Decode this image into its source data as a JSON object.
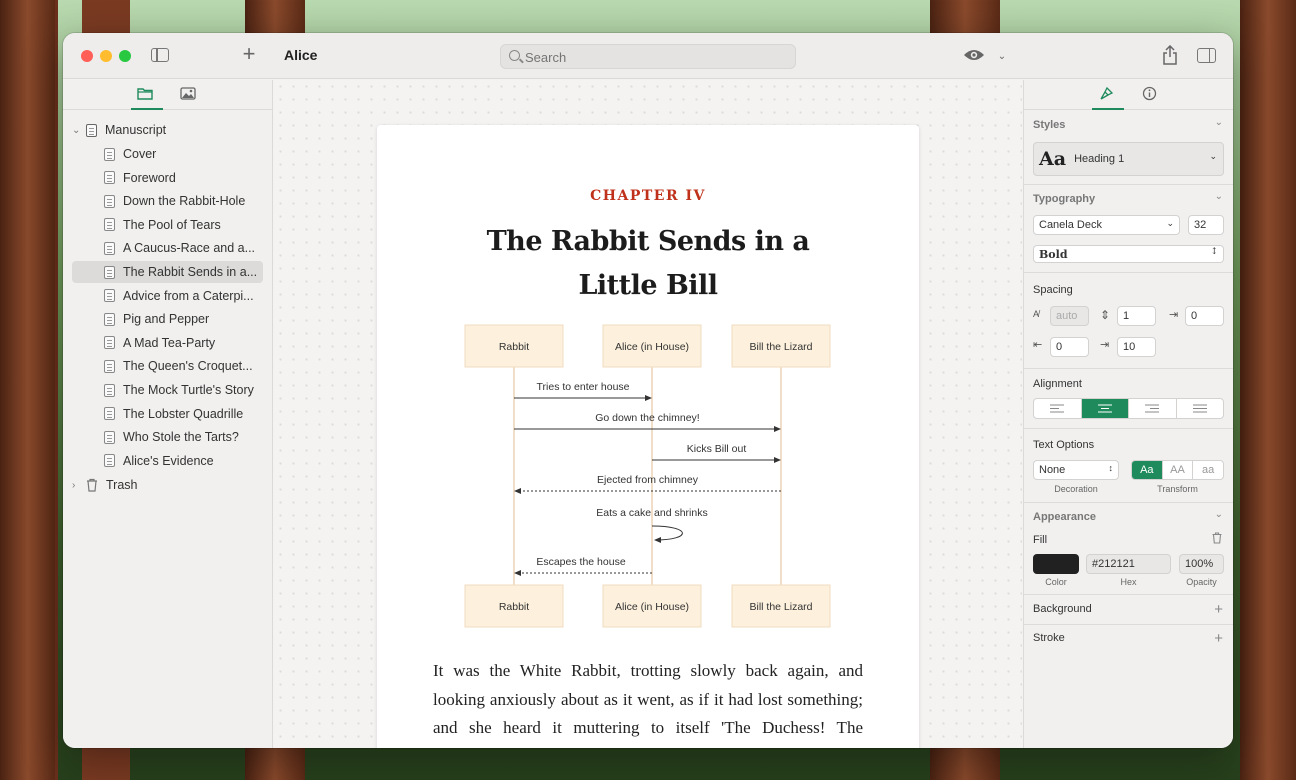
{
  "toolbar": {
    "title": "Alice",
    "search_placeholder": "Search"
  },
  "sidebar": {
    "root_label": "Manuscript",
    "items": [
      {
        "label": "Cover"
      },
      {
        "label": "Foreword"
      },
      {
        "label": "Down the Rabbit-Hole"
      },
      {
        "label": "The Pool of Tears"
      },
      {
        "label": "A Caucus-Race and a..."
      },
      {
        "label": "The Rabbit Sends in a...",
        "selected": true
      },
      {
        "label": "Advice from a Caterpi..."
      },
      {
        "label": "Pig and Pepper"
      },
      {
        "label": "A Mad Tea-Party"
      },
      {
        "label": "The Queen's Croquet..."
      },
      {
        "label": "The Mock Turtle's Story"
      },
      {
        "label": "The Lobster Quadrille"
      },
      {
        "label": "Who Stole the Tarts?"
      },
      {
        "label": "Alice's Evidence"
      }
    ],
    "trash_label": "Trash"
  },
  "page": {
    "chapter": "CHAPTER IV",
    "heading_line1": "The Rabbit Sends in a",
    "heading_line2": "Little Bill",
    "body": "It was the White Rabbit, trotting slowly back again, and looking anxiously about as it went, as if it had lost something; and she heard it muttering to itself 'The Duchess! The Duchess! Oh my"
  },
  "diagram": {
    "participants": [
      "Rabbit",
      "Alice (in House)",
      "Bill the Lizard"
    ],
    "messages": [
      {
        "from": 0,
        "to": 1,
        "label": "Tries to enter house",
        "style": "solid"
      },
      {
        "from": 0,
        "to": 2,
        "label": "Go down the chimney!",
        "style": "solid"
      },
      {
        "from": 1,
        "to": 2,
        "label": "Kicks Bill out",
        "style": "solid"
      },
      {
        "from": 2,
        "to": 0,
        "label": "Ejected from chimney",
        "style": "dashed"
      },
      {
        "from": 1,
        "to": 1,
        "label": "Eats a cake and shrinks",
        "style": "self"
      },
      {
        "from": 1,
        "to": 0,
        "label": "Escapes the house",
        "style": "dashed"
      }
    ]
  },
  "inspector": {
    "styles_title": "Styles",
    "style_preview": "Aa",
    "style_name": "Heading 1",
    "typography_title": "Typography",
    "font_family": "Canela Deck",
    "font_size": "32",
    "font_weight": "Bold",
    "spacing_title": "Spacing",
    "letter_spacing": "auto",
    "line_height": "1",
    "indent": "0",
    "space_before": "0",
    "space_after": "10",
    "alignment_title": "Alignment",
    "alignment_selected": "center",
    "text_options_title": "Text Options",
    "decoration": "None",
    "decoration_label": "Decoration",
    "transform_options": [
      "Aa",
      "AA",
      "aa"
    ],
    "transform_label": "Transform",
    "appearance_title": "Appearance",
    "fill_label": "Fill",
    "fill_color": "#212121",
    "hex": "#212121",
    "opacity": "100%",
    "color_caption": "Color",
    "hex_caption": "Hex",
    "opacity_caption": "Opacity",
    "background_label": "Background",
    "stroke_label": "Stroke"
  },
  "colors": {
    "accent": "#1f8a5c",
    "chapter_red": "#c0311b",
    "participant_fill": "#fdf1dd"
  }
}
